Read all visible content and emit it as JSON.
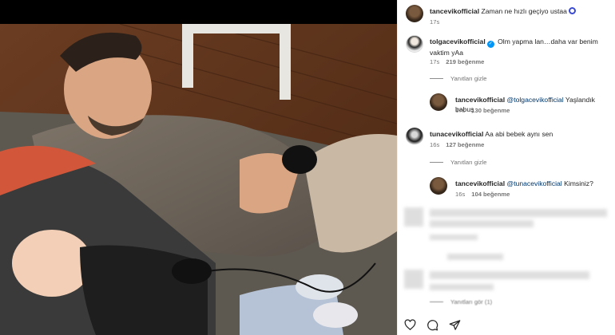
{
  "post": {
    "author": "tancevikofficial",
    "caption": "Zaman ne hızlı geçiyo ustaa",
    "time": "17s"
  },
  "comments": [
    {
      "user": "tolgacevikofficial",
      "text": "Olm yapma lan…daha var benim vaktim yAa",
      "time": "17s",
      "likes": "219 beğenme",
      "replies_toggle": "Yanıtları gizle",
      "replies": [
        {
          "user": "tancevikofficial",
          "mention": "@tolgacevikofficial",
          "text": "Yaşlandık babuş",
          "time": "17s",
          "likes": "130 beğenme"
        }
      ]
    },
    {
      "user": "tunacevikofficial",
      "text": "Aa abi bebek aynı sen",
      "time": "16s",
      "likes": "127 beğenme",
      "replies_toggle": "Yanıtları gizle",
      "replies": [
        {
          "user": "tancevikofficial",
          "mention": "@tunacevikofficial",
          "text": "Kimsiniz?",
          "time": "16s",
          "likes": "104 beğenme"
        }
      ]
    }
  ],
  "hidden_replies_toggle": "Yanıtları gör (1)",
  "actions": {
    "like": "heart-icon",
    "comment": "comment-icon",
    "share": "send-icon"
  },
  "colors": {
    "link": "#00376b",
    "verified": "#0095f6",
    "muted": "#737373"
  }
}
